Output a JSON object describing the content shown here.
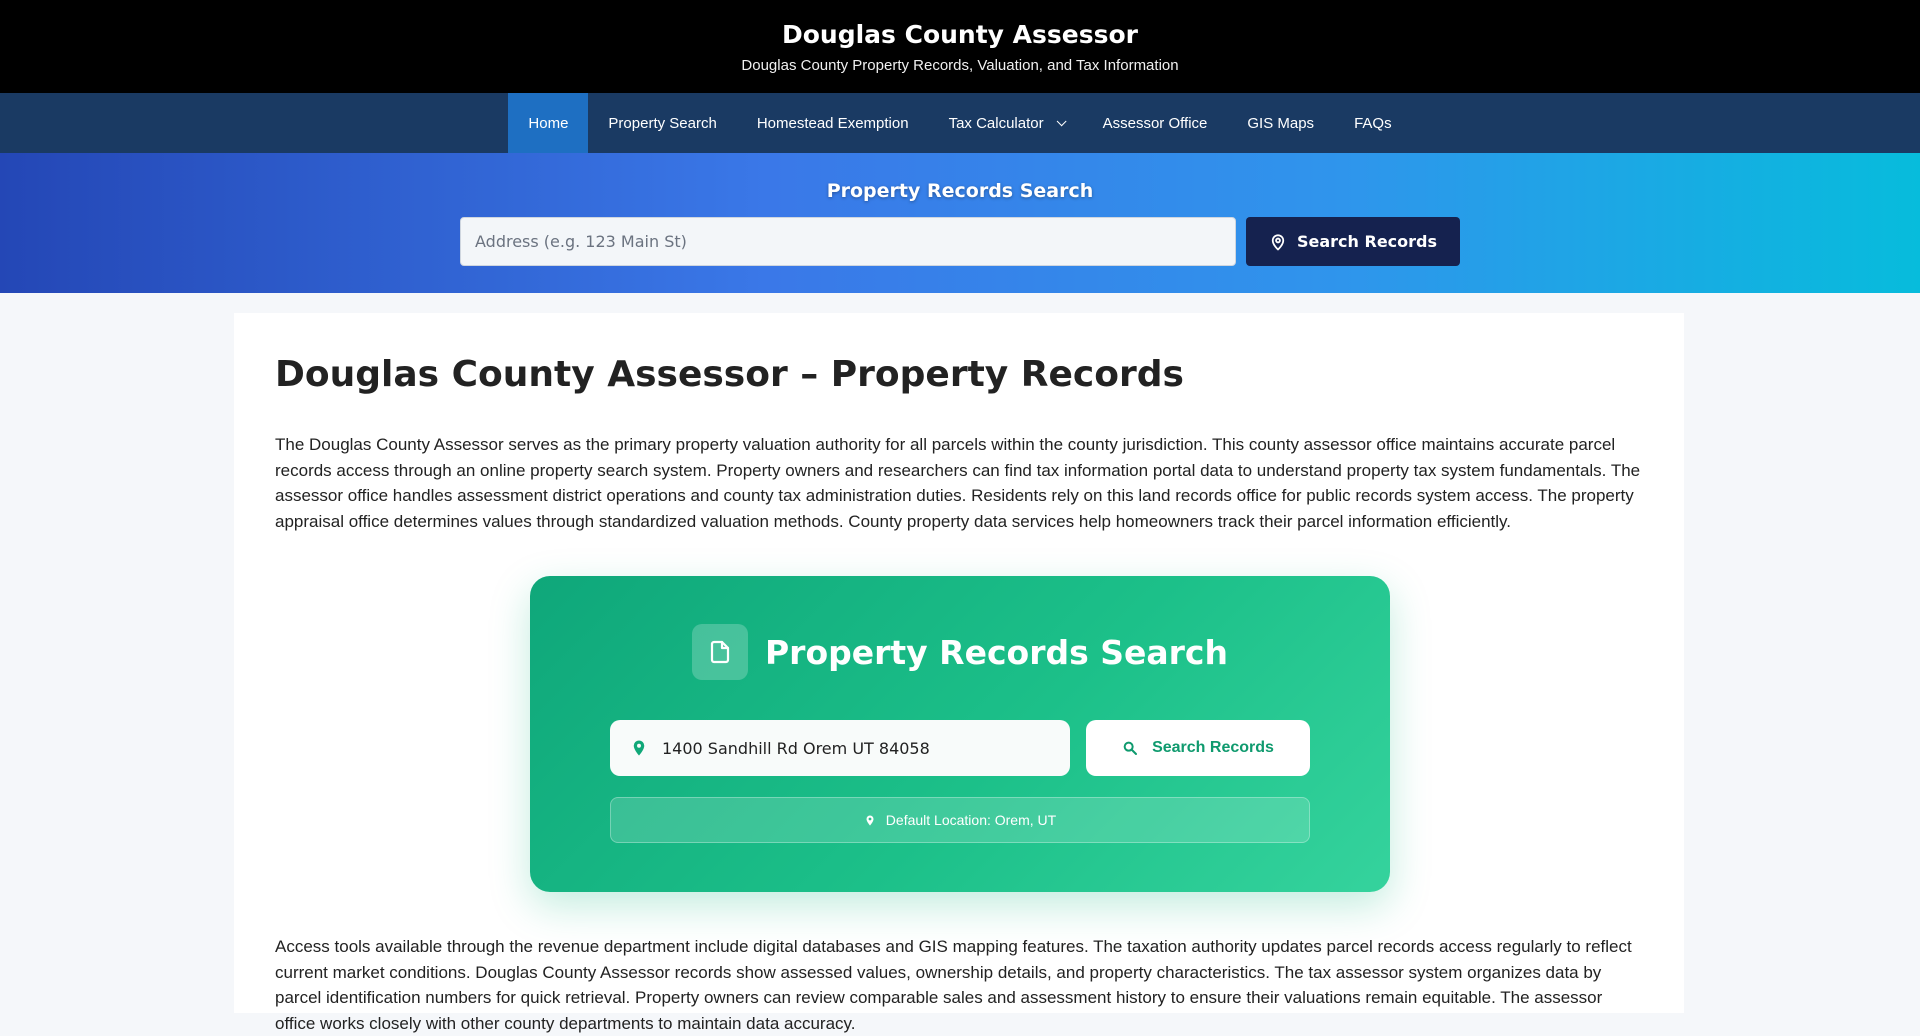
{
  "header": {
    "title": "Douglas County Assessor",
    "tagline": "Douglas County Property Records, Valuation, and Tax Information"
  },
  "nav": {
    "items": [
      {
        "label": "Home"
      },
      {
        "label": "Property Search"
      },
      {
        "label": "Homestead Exemption"
      },
      {
        "label": "Tax Calculator"
      },
      {
        "label": "Assessor Office"
      },
      {
        "label": "GIS Maps"
      },
      {
        "label": "FAQs"
      }
    ]
  },
  "hero": {
    "title": "Property Records Search",
    "placeholder": "Address (e.g. 123 Main St)",
    "button_label": "Search Records"
  },
  "main": {
    "heading": "Douglas County Assessor – Property Records",
    "intro": "The Douglas County Assessor serves as the primary property valuation authority for all parcels within the county jurisdiction. This county assessor office maintains accurate parcel records access through an online property search system. Property owners and researchers can find tax information portal data to understand property tax system fundamentals. The assessor office handles assessment district operations and county tax administration duties. Residents rely on this land records office for public records system access. The property appraisal office determines values through standardized valuation methods. County property data services help homeowners track their parcel information efficiently.",
    "access": "Access tools available through the revenue department include digital databases and GIS mapping features. The taxation authority updates parcel records access regularly to reflect current market conditions. Douglas County Assessor records show assessed values, ownership details, and property characteristics. The tax assessor system organizes data by parcel identification numbers for quick retrieval. Property owners can review comparable sales and assessment history to ensure their valuations remain equitable. The assessor office works closely with other county departments to maintain data accuracy."
  },
  "widget": {
    "title": "Property Records Search",
    "input_value": "1400 Sandhill Rd Orem UT 84058",
    "button_label": "Search Records",
    "default_location": "Default Location: Orem, UT"
  },
  "colors": {
    "header_bg": "#000000",
    "nav_bg": "#1a3a63",
    "nav_active": "#1e6fc2",
    "hero_button": "#15224f",
    "widget_green": "#10b981"
  }
}
